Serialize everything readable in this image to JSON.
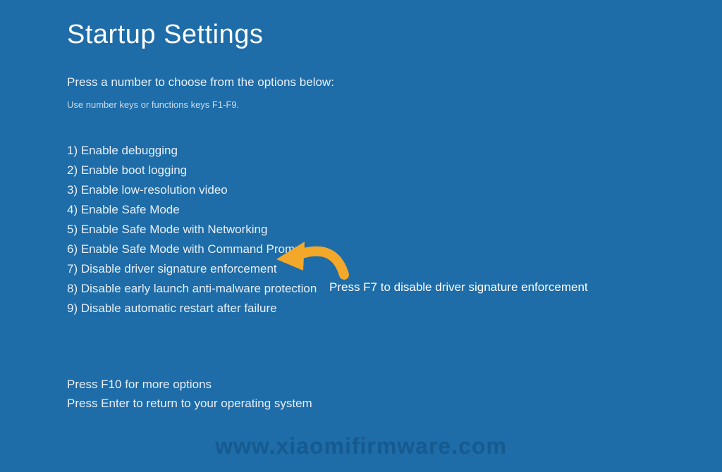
{
  "header": {
    "title": "Startup Settings",
    "instruction": "Press a number to choose from the options below:",
    "hint": "Use number keys or functions keys F1-F9."
  },
  "options": {
    "items": [
      {
        "label": "1) Enable debugging"
      },
      {
        "label": "2) Enable boot logging"
      },
      {
        "label": "3) Enable low-resolution video"
      },
      {
        "label": "4) Enable Safe Mode"
      },
      {
        "label": "5) Enable Safe Mode with Networking"
      },
      {
        "label": "6) Enable Safe Mode with Command Prompt"
      },
      {
        "label": "7) Disable driver signature enforcement"
      },
      {
        "label": "8) Disable early launch anti-malware protection"
      },
      {
        "label": "9) Disable automatic restart after failure"
      }
    ]
  },
  "footer": {
    "line1": "Press F10 for more options",
    "line2": "Press Enter to return to your operating system"
  },
  "annotation": {
    "text": "Press F7 to disable driver signature enforcement"
  },
  "watermark": "www.xiaomifirmware.com",
  "colors": {
    "background": "#1e6ca8",
    "text": "#ffffff",
    "arrow": "#f3a82a"
  }
}
